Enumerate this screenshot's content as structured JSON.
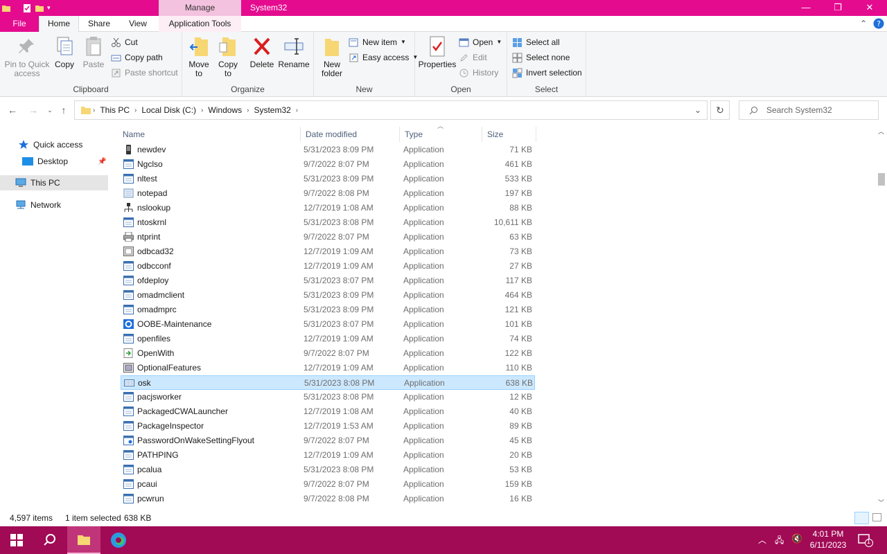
{
  "window": {
    "title": "System32",
    "context_tab": "Manage",
    "minimize_symbol": "—",
    "restore_symbol": "❐",
    "close_symbol": "✕"
  },
  "tabs": {
    "file": "File",
    "home": "Home",
    "share": "Share",
    "view": "View",
    "app_tools": "Application Tools"
  },
  "ribbon": {
    "clipboard": {
      "label": "Clipboard",
      "pin": "Pin to Quick access",
      "copy": "Copy",
      "paste": "Paste",
      "cut": "Cut",
      "copy_path": "Copy path",
      "paste_shortcut": "Paste shortcut"
    },
    "organize": {
      "label": "Organize",
      "move_to": "Move to",
      "copy_to": "Copy to",
      "delete": "Delete",
      "rename": "Rename"
    },
    "new": {
      "label": "New",
      "new_folder": "New folder",
      "new_item": "New item",
      "easy_access": "Easy access"
    },
    "open": {
      "label": "Open",
      "properties": "Properties",
      "open": "Open",
      "edit": "Edit",
      "history": "History"
    },
    "select": {
      "label": "Select",
      "select_all": "Select all",
      "select_none": "Select none",
      "invert_selection": "Invert selection"
    }
  },
  "address": {
    "crumbs": [
      "This PC",
      "Local Disk (C:)",
      "Windows",
      "System32"
    ],
    "search_placeholder": "Search System32"
  },
  "nav": {
    "quick_access": "Quick access",
    "desktop": "Desktop",
    "this_pc": "This PC",
    "network": "Network"
  },
  "columns": {
    "name": "Name",
    "date": "Date modified",
    "type": "Type",
    "size": "Size"
  },
  "files": [
    {
      "name": "newdev",
      "date": "5/31/2023 8:09 PM",
      "type": "Application",
      "size": "71 KB",
      "icon": "device-icon"
    },
    {
      "name": "Ngclso",
      "date": "9/7/2022 8:07 PM",
      "type": "Application",
      "size": "461 KB",
      "icon": "app-window-icon"
    },
    {
      "name": "nltest",
      "date": "5/31/2023 8:09 PM",
      "type": "Application",
      "size": "533 KB",
      "icon": "app-window-icon"
    },
    {
      "name": "notepad",
      "date": "9/7/2022 8:08 PM",
      "type": "Application",
      "size": "197 KB",
      "icon": "notepad-icon"
    },
    {
      "name": "nslookup",
      "date": "12/7/2019 1:08 AM",
      "type": "Application",
      "size": "88 KB",
      "icon": "network-lookup-icon"
    },
    {
      "name": "ntoskrnl",
      "date": "5/31/2023 8:08 PM",
      "type": "Application",
      "size": "10,611 KB",
      "icon": "app-window-icon"
    },
    {
      "name": "ntprint",
      "date": "9/7/2022 8:07 PM",
      "type": "Application",
      "size": "63 KB",
      "icon": "printer-icon"
    },
    {
      "name": "odbcad32",
      "date": "12/7/2019 1:09 AM",
      "type": "Application",
      "size": "73 KB",
      "icon": "database-icon"
    },
    {
      "name": "odbcconf",
      "date": "12/7/2019 1:09 AM",
      "type": "Application",
      "size": "27 KB",
      "icon": "app-window-icon"
    },
    {
      "name": "ofdeploy",
      "date": "5/31/2023 8:07 PM",
      "type": "Application",
      "size": "117 KB",
      "icon": "app-window-icon"
    },
    {
      "name": "omadmclient",
      "date": "5/31/2023 8:09 PM",
      "type": "Application",
      "size": "464 KB",
      "icon": "app-window-icon"
    },
    {
      "name": "omadmprc",
      "date": "5/31/2023 8:09 PM",
      "type": "Application",
      "size": "121 KB",
      "icon": "app-window-icon"
    },
    {
      "name": "OOBE-Maintenance",
      "date": "5/31/2023 8:07 PM",
      "type": "Application",
      "size": "101 KB",
      "icon": "gear-icon"
    },
    {
      "name": "openfiles",
      "date": "12/7/2019 1:09 AM",
      "type": "Application",
      "size": "74 KB",
      "icon": "app-window-icon"
    },
    {
      "name": "OpenWith",
      "date": "9/7/2022 8:07 PM",
      "type": "Application",
      "size": "122 KB",
      "icon": "open-with-icon"
    },
    {
      "name": "OptionalFeatures",
      "date": "12/7/2019 1:09 AM",
      "type": "Application",
      "size": "110 KB",
      "icon": "features-icon"
    },
    {
      "name": "osk",
      "date": "5/31/2023 8:08 PM",
      "type": "Application",
      "size": "638 KB",
      "icon": "keyboard-icon",
      "selected": true
    },
    {
      "name": "pacjsworker",
      "date": "5/31/2023 8:08 PM",
      "type": "Application",
      "size": "12 KB",
      "icon": "app-window-icon"
    },
    {
      "name": "PackagedCWALauncher",
      "date": "12/7/2019 1:08 AM",
      "type": "Application",
      "size": "40 KB",
      "icon": "app-window-icon"
    },
    {
      "name": "PackageInspector",
      "date": "12/7/2019 1:53 AM",
      "type": "Application",
      "size": "89 KB",
      "icon": "app-window-icon"
    },
    {
      "name": "PasswordOnWakeSettingFlyout",
      "date": "9/7/2022 8:07 PM",
      "type": "Application",
      "size": "45 KB",
      "icon": "settings-window-icon"
    },
    {
      "name": "PATHPING",
      "date": "12/7/2019 1:09 AM",
      "type": "Application",
      "size": "20 KB",
      "icon": "app-window-icon"
    },
    {
      "name": "pcalua",
      "date": "5/31/2023 8:08 PM",
      "type": "Application",
      "size": "53 KB",
      "icon": "app-window-icon"
    },
    {
      "name": "pcaui",
      "date": "9/7/2022 8:07 PM",
      "type": "Application",
      "size": "159 KB",
      "icon": "app-window-icon"
    },
    {
      "name": "pcwrun",
      "date": "9/7/2022 8:08 PM",
      "type": "Application",
      "size": "16 KB",
      "icon": "app-window-icon"
    }
  ],
  "status": {
    "count": "4,597 items",
    "selected": "1 item selected",
    "size": "638 KB"
  },
  "taskbar": {
    "time": "4:01 PM",
    "date": "6/11/2023",
    "notification_count": "1"
  },
  "colors": {
    "accent": "#e40b8f",
    "taskbar": "#a10a55",
    "selection": "#cce8ff"
  }
}
